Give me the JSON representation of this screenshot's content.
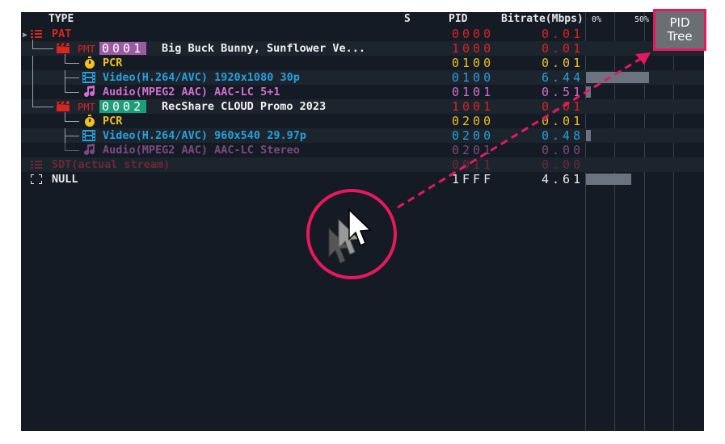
{
  "header": {
    "type": "TYPE",
    "s": "S",
    "pid": "PID",
    "bitrate": "Bitrate(Mbps)",
    "pct0": "0%",
    "pct50": "50%"
  },
  "pid_tree_button": {
    "line1": "PID",
    "line2": "Tree"
  },
  "rows": [
    {
      "label": "PAT",
      "pid": "0000",
      "bitrate": "0.01",
      "color": "#d9241f",
      "bar": 0
    },
    {
      "tag": "PMT",
      "program": "0001",
      "program_color": "#9b5aa3",
      "label": "Big Buck Bunny, Sunflower Ve...",
      "pid": "1000",
      "bitrate": "0.01",
      "color": "#d9241f",
      "bar": 0
    },
    {
      "label": "PCR",
      "pid": "0100",
      "bitrate": "0.01",
      "color": "#f0c020",
      "bar": 0
    },
    {
      "label": "Video(H.264/AVC) 1920x1080 30p",
      "pid": "0100",
      "bitrate": "6.44",
      "color": "#28a0dc",
      "bar": 0.89
    },
    {
      "label": "Audio(MPEG2 AAC) AAC-LC 5+1",
      "pid": "0101",
      "bitrate": "0.51",
      "color": "#d26ed2",
      "bar": 0.07
    },
    {
      "tag": "PMT",
      "program": "0002",
      "program_color": "#1e9e78",
      "label": "RecShare CLOUD Promo 2023",
      "pid": "1001",
      "bitrate": "0.01",
      "color": "#d9241f",
      "bar": 0
    },
    {
      "label": "PCR",
      "pid": "0200",
      "bitrate": "0.01",
      "color": "#f0c020",
      "bar": 0
    },
    {
      "label": "Video(H.264/AVC) 960x540 29.97p",
      "pid": "0200",
      "bitrate": "0.48",
      "color": "#28a0dc",
      "bar": 0.07
    },
    {
      "label": "Audio(MPEG2 AAC) AAC-LC Stereo",
      "pid": "0201",
      "bitrate": "0.00",
      "color": "#7a4a82",
      "bar": 0
    },
    {
      "label": "SDT(actual stream)",
      "pid": "0011",
      "bitrate": "0.00",
      "color": "#6a2a30",
      "bar": 0
    },
    {
      "label": "NULL",
      "pid": "1FFF",
      "bitrate": "4.61",
      "color": "#e8e8e8",
      "bar": 0.64
    }
  ]
}
